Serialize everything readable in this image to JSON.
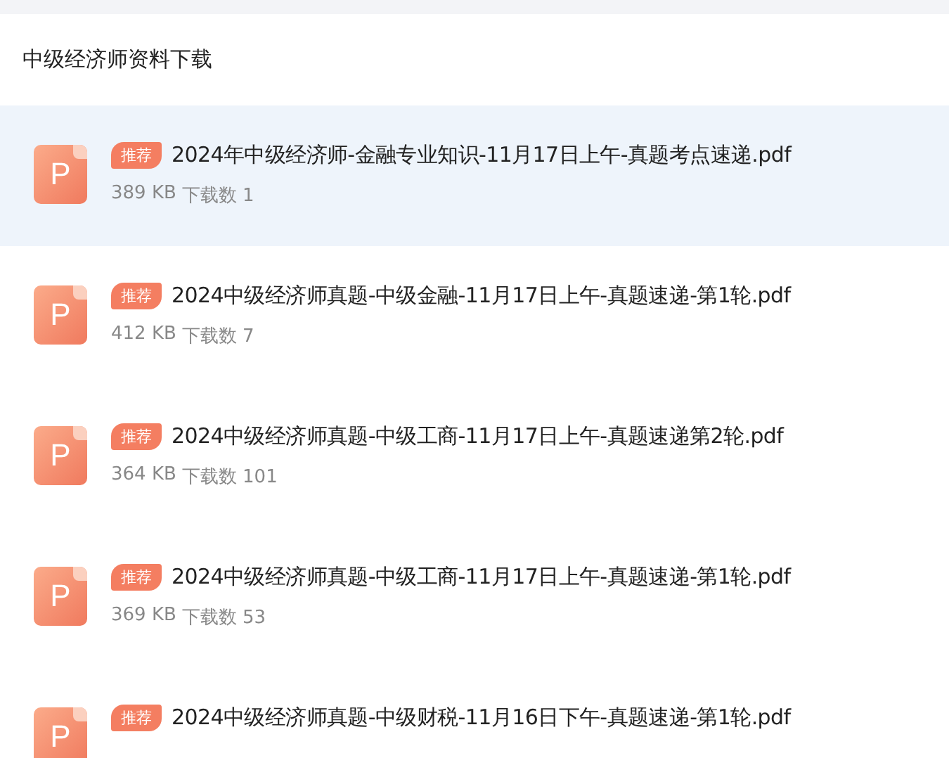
{
  "section": {
    "title": "中级经济师资料下载"
  },
  "files": [
    {
      "icon_letter": "P",
      "badge": "推荐",
      "name": "2024年中级经济师-金融专业知识-11月17日上午-真题考点速递.pdf",
      "size": "389 KB",
      "downloads_label": "下载数",
      "downloads": "1",
      "selected": true
    },
    {
      "icon_letter": "P",
      "badge": "推荐",
      "name": "2024中级经济师真题-中级金融-11月17日上午-真题速递-第1轮.pdf",
      "size": "412 KB",
      "downloads_label": "下载数",
      "downloads": "7",
      "selected": false
    },
    {
      "icon_letter": "P",
      "badge": "推荐",
      "name": "2024中级经济师真题-中级工商-11月17日上午-真题速递第2轮.pdf",
      "size": "364 KB",
      "downloads_label": "下载数",
      "downloads": "101",
      "selected": false
    },
    {
      "icon_letter": "P",
      "badge": "推荐",
      "name": "2024中级经济师真题-中级工商-11月17日上午-真题速递-第1轮.pdf",
      "size": "369 KB",
      "downloads_label": "下载数",
      "downloads": "53",
      "selected": false
    },
    {
      "icon_letter": "P",
      "badge": "推荐",
      "name": "2024中级经济师真题-中级财税-11月16日下午-真题速递-第1轮.pdf",
      "selected": false
    }
  ]
}
